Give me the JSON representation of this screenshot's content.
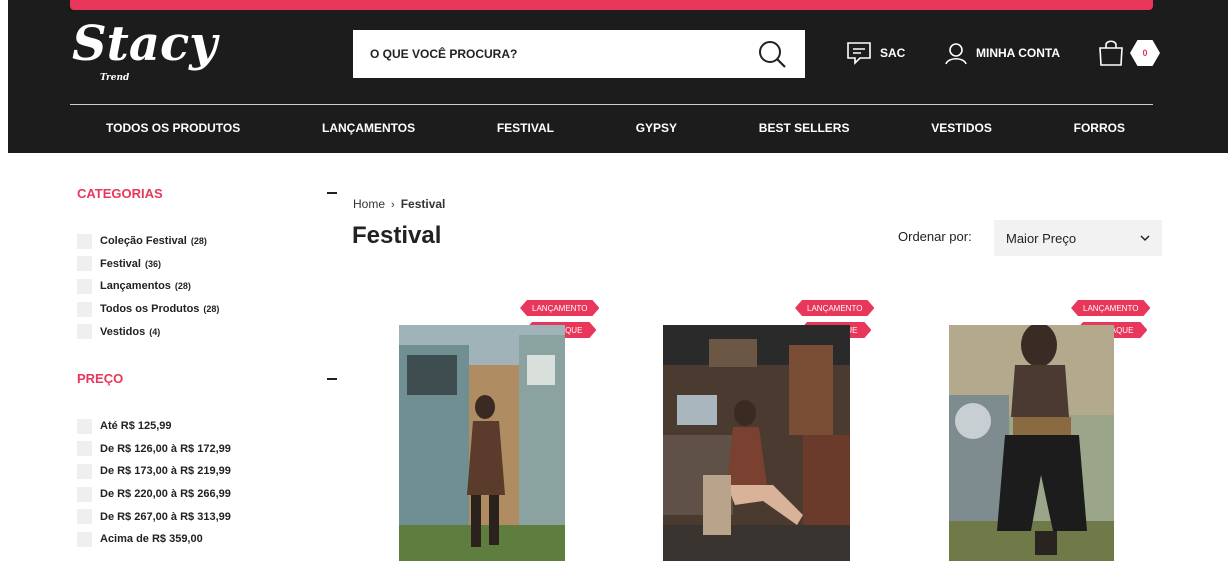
{
  "brand": {
    "logo_text": "Stacy",
    "logo_sub": "Trend",
    "accent": "#e8375a"
  },
  "search": {
    "placeholder": "O QUE VOCÊ PROCURA?"
  },
  "header": {
    "sac_label": "SAC",
    "account_label": "MINHA CONTA",
    "cart_count": "0"
  },
  "nav": [
    "TODOS OS PRODUTOS",
    "LANÇAMENTOS",
    "FESTIVAL",
    "GYPSY",
    "BEST SELLERS",
    "VESTIDOS",
    "FORROS"
  ],
  "filters": {
    "categories": {
      "title": "CATEGORIAS",
      "items": [
        {
          "label": "Coleção Festival",
          "count": "(28)"
        },
        {
          "label": "Festival",
          "count": "(36)"
        },
        {
          "label": "Lançamentos",
          "count": "(28)"
        },
        {
          "label": "Todos os Produtos",
          "count": "(28)"
        },
        {
          "label": "Vestidos",
          "count": "(4)"
        }
      ]
    },
    "price": {
      "title": "PREÇO",
      "items": [
        "Até R$ 125,99",
        "De R$ 126,00 à R$ 172,99",
        "De R$ 173,00 à R$ 219,99",
        "De R$ 220,00 à R$ 266,99",
        "De R$ 267,00 à R$ 313,99",
        "Acima de R$ 359,00"
      ]
    }
  },
  "breadcrumb": {
    "home": "Home",
    "separator": "›",
    "current": "Festival"
  },
  "page_title": "Festival",
  "sort": {
    "label": "Ordenar por:",
    "selected": "Maior Preço"
  },
  "products": [
    {
      "badges": [
        "LANÇAMENTO",
        "DESTAQUE"
      ]
    },
    {
      "badges": [
        "LANÇAMENTO",
        "DESTAQUE"
      ]
    },
    {
      "badges": [
        "LANÇAMENTO",
        "DESTAQUE"
      ]
    }
  ]
}
